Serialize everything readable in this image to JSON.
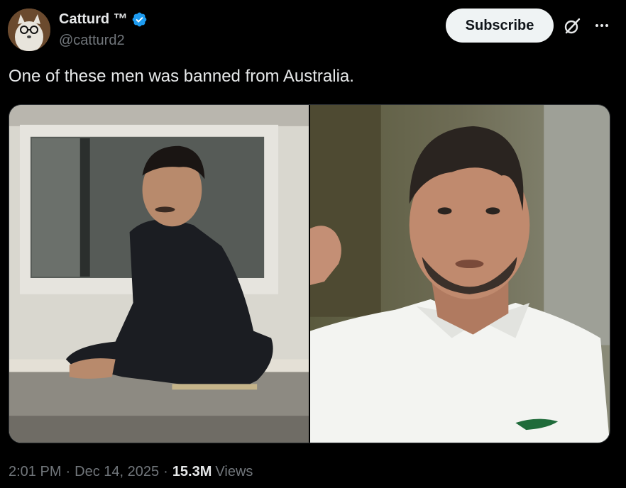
{
  "author": {
    "name": "Catturd ™",
    "handle": "@catturd2",
    "verified": true,
    "verified_color": "#1d9bf0"
  },
  "actions": {
    "subscribe_label": "Subscribe",
    "grok_icon": "grok-icon",
    "more_icon": "more-icon"
  },
  "tweet": {
    "text": "One of these men was banned from Australia."
  },
  "media": [
    {
      "description": "photo-left",
      "icon": "photo"
    },
    {
      "description": "photo-right",
      "icon": "photo"
    }
  ],
  "meta": {
    "time": "2:01 PM",
    "date": "Dec 14, 2025",
    "views_count": "15.3M",
    "views_label": "Views"
  },
  "colors": {
    "background": "#000000",
    "text_primary": "#e7e9ea",
    "text_secondary": "#71767b",
    "button_bg": "#eff3f4"
  }
}
